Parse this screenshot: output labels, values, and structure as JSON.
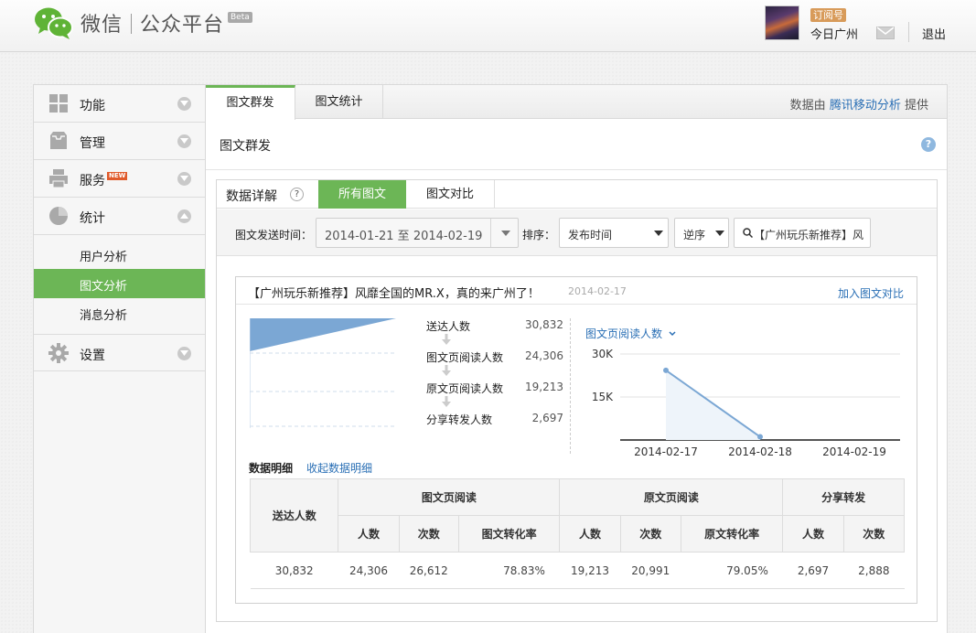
{
  "brand": {
    "name": "微信",
    "product": "公众平台",
    "beta": "Beta"
  },
  "account": {
    "type": "订阅号",
    "name": "今日广州",
    "logout": "退出"
  },
  "sidebar": {
    "items": [
      {
        "label": "功能"
      },
      {
        "label": "管理"
      },
      {
        "label": "服务",
        "badge": "NEW"
      },
      {
        "label": "统计"
      },
      {
        "label": "设置"
      }
    ],
    "subitems": [
      {
        "label": "用户分析"
      },
      {
        "label": "图文分析"
      },
      {
        "label": "消息分析"
      }
    ]
  },
  "tabs": [
    {
      "label": "图文群发"
    },
    {
      "label": "图文统计"
    }
  ],
  "provider": {
    "prefix": "数据由",
    "link": "腾讯移动分析",
    "suffix": "提供"
  },
  "page_title": "图文群发",
  "help": "?",
  "data_head": {
    "label": "数据详解",
    "tabs": [
      {
        "label": "所有图文"
      },
      {
        "label": "图文对比"
      }
    ]
  },
  "filters": {
    "date_label": "图文发送时间：",
    "date_range": "2014-01-21 至 2014-02-19",
    "sort_label": "排序：",
    "sort_value": "发布时间",
    "order_value": "逆序",
    "search_value": "【广州玩乐新推荐】风"
  },
  "article": {
    "title": "【广州玩乐新推荐】风靡全国的MR.X，真的来广州了！",
    "date": "2014-02-17",
    "action": "加入图文对比"
  },
  "funnel": [
    {
      "name": "送达人数",
      "value": "30,832"
    },
    {
      "name": "图文页阅读人数",
      "value": "24,306"
    },
    {
      "name": "原文页阅读人数",
      "value": "19,213"
    },
    {
      "name": "分享转发人数",
      "value": "2,697"
    }
  ],
  "chart_select": "图文页阅读人数",
  "chart_data": {
    "type": "line",
    "x": [
      "2014-02-17",
      "2014-02-18",
      "2014-02-19"
    ],
    "series": [
      {
        "name": "图文页阅读人数",
        "values": [
          24306,
          1100,
          null
        ]
      }
    ],
    "ylim": [
      0,
      30000
    ],
    "yticks": [
      "30K",
      "15K"
    ],
    "grid": true
  },
  "details": {
    "label": "数据明细",
    "toggle": "收起数据明细",
    "group_headers": [
      "送达人数",
      "图文页阅读",
      "原文页阅读",
      "分享转发"
    ],
    "sub_headers": [
      "人数",
      "次数",
      "图文转化率",
      "人数",
      "次数",
      "原文转化率",
      "人数",
      "次数"
    ],
    "row": [
      "30,832",
      "24,306",
      "26,612",
      "78.83%",
      "19,213",
      "20,991",
      "79.05%",
      "2,697",
      "2,888"
    ]
  },
  "colors": {
    "accent": "#6cb656",
    "link": "#2a6fb5",
    "chart_line": "#7ba7d4"
  }
}
